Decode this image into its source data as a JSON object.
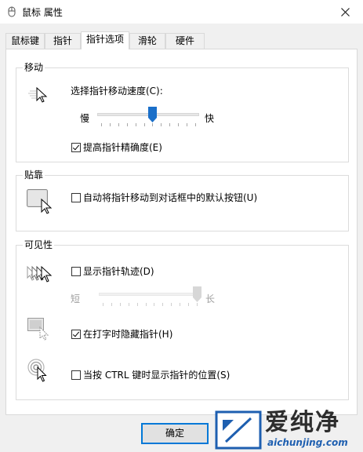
{
  "window": {
    "title": "鼠标 属性"
  },
  "tabs": [
    {
      "label": "鼠标键"
    },
    {
      "label": "指针"
    },
    {
      "label": "指针选项",
      "active": true
    },
    {
      "label": "滑轮"
    },
    {
      "label": "硬件"
    }
  ],
  "motion": {
    "title": "移动",
    "speed_label": "选择指针移动速度(C):",
    "slow_label": "慢",
    "fast_label": "快",
    "speed_value": 6,
    "speed_max": 11,
    "precision_label": "提高指针精确度(E)",
    "precision_checked": true
  },
  "snap": {
    "title": "贴靠",
    "snap_label": "自动将指针移动到对话框中的默认按钮(U)",
    "snap_checked": false
  },
  "visibility": {
    "title": "可见性",
    "trails_label": "显示指针轨迹(D)",
    "trails_checked": false,
    "short_label": "短",
    "long_label": "长",
    "trails_value": 11,
    "trails_max": 11,
    "hide_label": "在打字时隐藏指针(H)",
    "hide_checked": true,
    "ctrl_label": "当按 CTRL 键时显示指针的位置(S)",
    "ctrl_checked": false
  },
  "buttons": {
    "ok_label": "确定"
  },
  "watermark": {
    "brand": "爱纯净",
    "url": "aichunjing.com"
  },
  "colors": {
    "accent": "#0078d7",
    "thumb": "#1a6fc9"
  }
}
